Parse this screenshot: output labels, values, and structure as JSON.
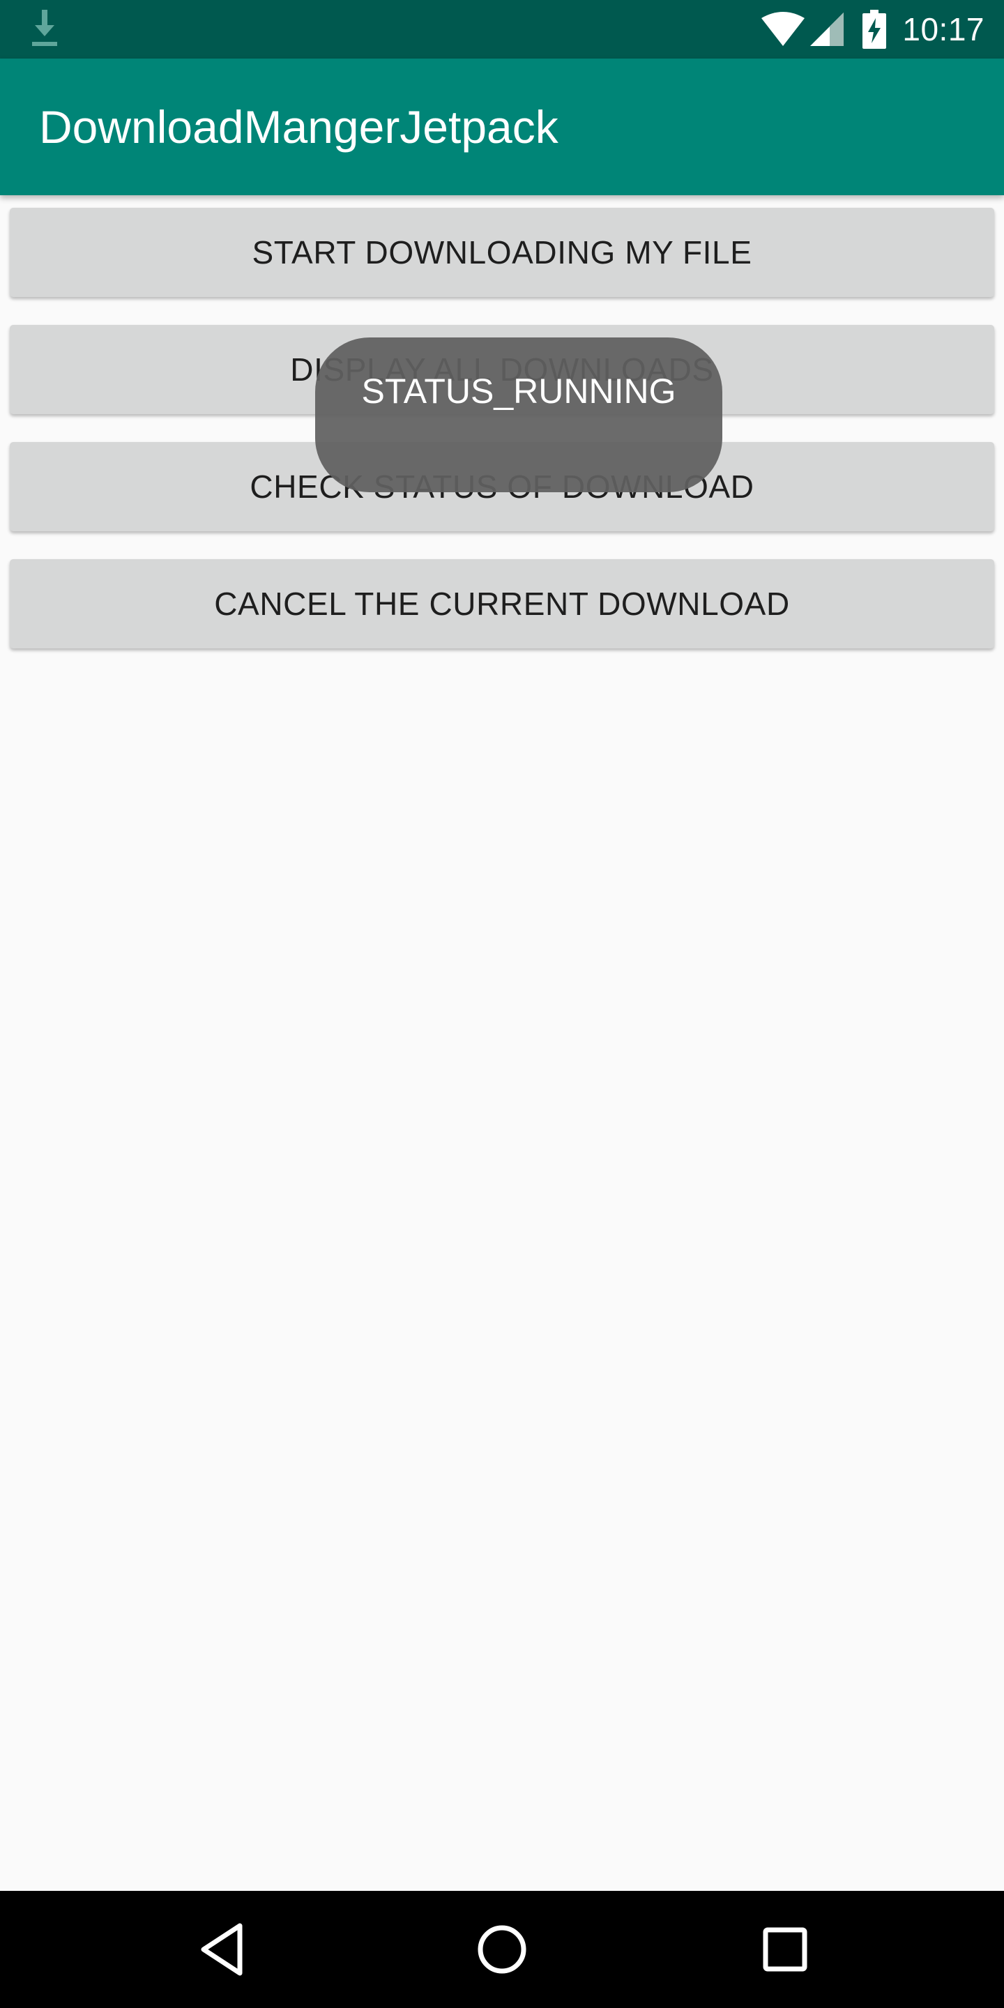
{
  "status_bar": {
    "time": "10:17",
    "icons": [
      "download-icon",
      "wifi-icon",
      "cell-signal-icon",
      "battery-charging-icon"
    ]
  },
  "app_bar": {
    "title": "DownloadMangerJetpack"
  },
  "buttons": [
    "START DOWNLOADING MY FILE",
    "DISPLAY ALL DOWNLOADS",
    "CHECK STATUS OF DOWNLOAD",
    "CANCEL THE CURRENT DOWNLOAD"
  ],
  "toast": {
    "message": "STATUS_RUNNING"
  },
  "nav_bar": {
    "icons": [
      "back-icon",
      "home-icon",
      "recents-icon"
    ]
  },
  "colors": {
    "status_bar": "#00594f",
    "app_bar": "#008577",
    "button": "#d6d7d7",
    "background": "#fafafa",
    "toast": "#606060"
  }
}
